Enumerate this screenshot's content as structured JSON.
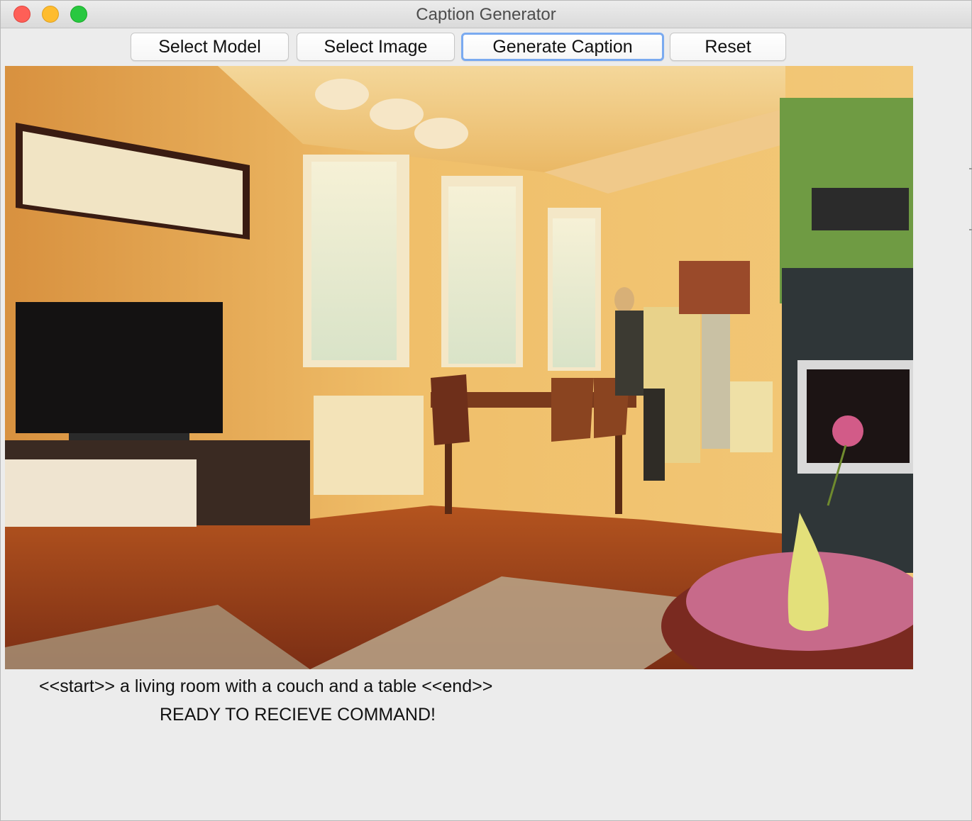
{
  "window": {
    "title": "Caption Generator"
  },
  "toolbar": {
    "select_model_label": "Select Model",
    "select_image_label": "Select Image",
    "generate_caption_label": "Generate Caption",
    "reset_label": "Reset"
  },
  "caption": {
    "text": "<<start>> a living room with a couch and a table <<end>>"
  },
  "status": {
    "text": "READY TO RECIEVE COMMAND!"
  },
  "colors": {
    "close": "#fe5f57",
    "minimize": "#febc2e",
    "maximize": "#28c840",
    "focus_ring": "#7aaaf0"
  }
}
